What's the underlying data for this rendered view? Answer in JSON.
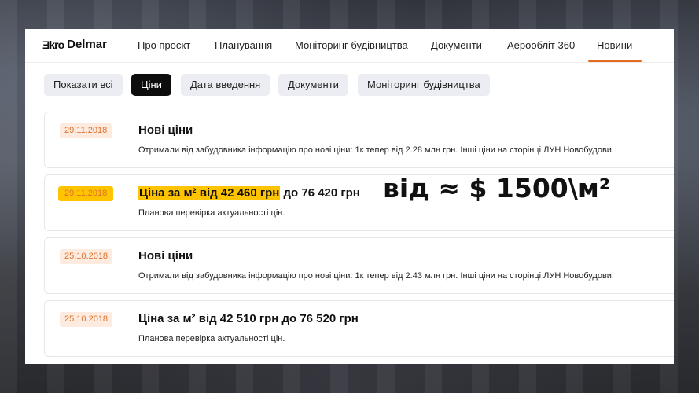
{
  "header": {
    "logo_mark": "Ǝkro",
    "logo_text": "Delmar",
    "nav": [
      {
        "label": "Про проєкт"
      },
      {
        "label": "Планування"
      },
      {
        "label": "Моніторинг будівництва"
      },
      {
        "label": "Документи"
      },
      {
        "label": "Аерооблiт 360"
      },
      {
        "label": "Новини",
        "active": true
      }
    ],
    "accent_color": "#e26b1f"
  },
  "filters": [
    {
      "label": "Показати всі"
    },
    {
      "label": "Ціни",
      "active": true
    },
    {
      "label": "Дата введення"
    },
    {
      "label": "Документи"
    },
    {
      "label": "Моніторинг будівництва"
    }
  ],
  "news": [
    {
      "date": "29.11.2018",
      "title": "Нові ціни",
      "desc": "Отримали від забудовника інформацію про нові ціни: 1к тепер від 2.28 млн грн. Інші ціни на сторінці ЛУН Новобудови."
    },
    {
      "date": "29.11.2018",
      "title_highlight": "Ціна за м² від 42 460 грн",
      "title_rest": " до 76 420 грн",
      "desc": "Планова перевірка актуальності цін.",
      "highlighted": true
    },
    {
      "date": "25.10.2018",
      "title": "Нові ціни",
      "desc": "Отримали від забудовника інформацію про нові ціни: 1к тепер від 2.43 млн грн. Інші ціни на сторінці ЛУН Новобудови."
    },
    {
      "date": "25.10.2018",
      "title": "Ціна за м² від 42 510 грн до 76 520 грн",
      "desc": "Планова перевірка актуальності цін."
    }
  ],
  "overlay": {
    "price_note": "від ≈ $ 1500\\м²"
  },
  "colors": {
    "highlight": "#ffc400",
    "date_text": "#e0712d",
    "date_bg": "#fdebdf"
  }
}
